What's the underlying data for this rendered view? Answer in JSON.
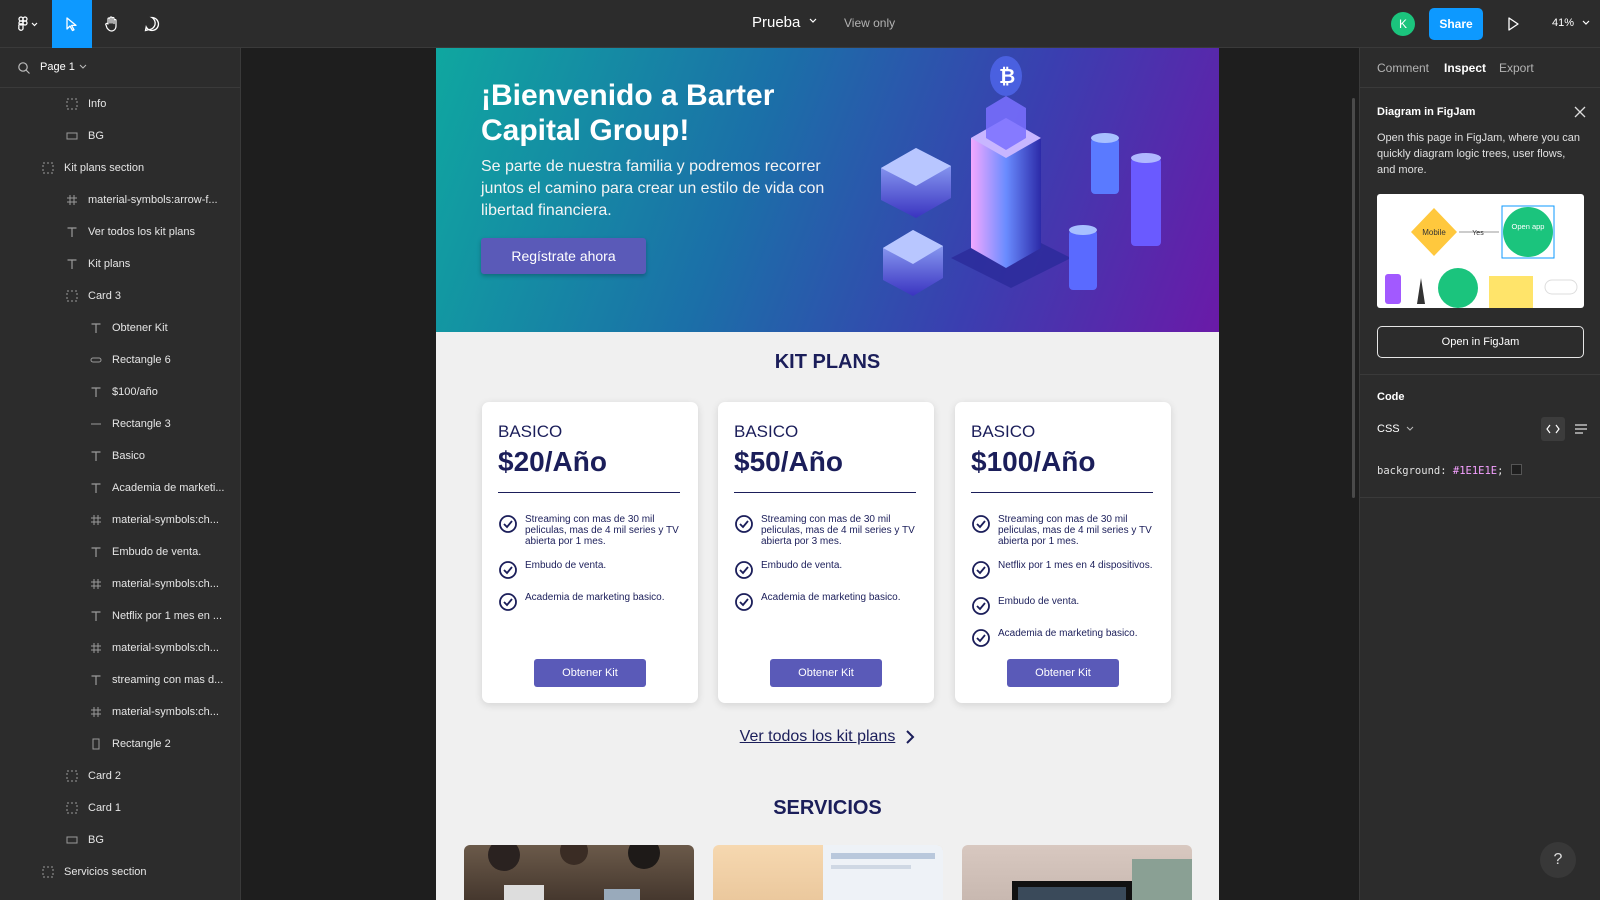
{
  "toolbar": {
    "doc_title": "Prueba",
    "view_only": "View only",
    "avatar_initial": "K",
    "share_label": "Share",
    "zoom": "41%"
  },
  "layers": {
    "page_label": "Page 1",
    "items": [
      {
        "name": "Info",
        "icon": "frame-dashed-icon",
        "indent": 1
      },
      {
        "name": "BG",
        "icon": "rectangle-icon",
        "indent": 1
      },
      {
        "name": "Kit plans section",
        "icon": "frame-dashed-icon",
        "indent": 0
      },
      {
        "name": "material-symbols:arrow-f...",
        "icon": "frame-grid-icon",
        "indent": 1
      },
      {
        "name": "Ver todos los kit plans",
        "icon": "text-icon",
        "indent": 1
      },
      {
        "name": "Kit plans",
        "icon": "text-icon",
        "indent": 1
      },
      {
        "name": "Card 3",
        "icon": "frame-dashed-icon",
        "indent": 1
      },
      {
        "name": "Obtener Kit",
        "icon": "text-icon",
        "indent": 2
      },
      {
        "name": "Rectangle 6",
        "icon": "rounded-rect-icon",
        "indent": 2
      },
      {
        "name": "$100/año",
        "icon": "text-icon",
        "indent": 2
      },
      {
        "name": "Rectangle 3",
        "icon": "line-icon",
        "indent": 2
      },
      {
        "name": "Basico",
        "icon": "text-icon",
        "indent": 2
      },
      {
        "name": "Academia de marketi...",
        "icon": "text-icon",
        "indent": 2
      },
      {
        "name": "material-symbols:ch...",
        "icon": "frame-grid-icon",
        "indent": 2
      },
      {
        "name": "Embudo de venta.",
        "icon": "text-icon",
        "indent": 2
      },
      {
        "name": "material-symbols:ch...",
        "icon": "frame-grid-icon",
        "indent": 2
      },
      {
        "name": "Netflix por 1 mes en ...",
        "icon": "text-icon",
        "indent": 2
      },
      {
        "name": "material-symbols:ch...",
        "icon": "frame-grid-icon",
        "indent": 2
      },
      {
        "name": "streaming con mas d...",
        "icon": "text-icon",
        "indent": 2
      },
      {
        "name": "material-symbols:ch...",
        "icon": "frame-grid-icon",
        "indent": 2
      },
      {
        "name": "Rectangle 2",
        "icon": "tall-rect-icon",
        "indent": 2
      },
      {
        "name": "Card 2",
        "icon": "frame-dashed-icon",
        "indent": 1
      },
      {
        "name": "Card 1",
        "icon": "frame-dashed-icon",
        "indent": 1
      },
      {
        "name": "BG",
        "icon": "rectangle-icon",
        "indent": 1
      },
      {
        "name": "Servicios section",
        "icon": "frame-dashed-icon",
        "indent": 0
      }
    ]
  },
  "hero": {
    "title": "¡Bienvenido a Barter Capital Group!",
    "subtitle": "Se parte de nuestra familia y podremos recorrer juntos el camino para crear un estilo de vida con libertad financiera.",
    "cta": "Regístrate ahora"
  },
  "kit_plans": {
    "title": "KIT PLANS",
    "cards": [
      {
        "tier": "BASICO",
        "price": "$20/Año",
        "features": [
          "Streaming  con mas de 30 mil peliculas, mas de 4 mil series y TV abierta por 1 mes.",
          "Embudo de venta.",
          "Academia de marketing basico."
        ],
        "button": "Obtener Kit"
      },
      {
        "tier": "BASICO",
        "price": "$50/Año",
        "features": [
          "Streaming  con mas de 30 mil peliculas, mas de 4 mil series y TV abierta por 3 mes.",
          "Embudo de venta.",
          "Academia de marketing basico."
        ],
        "button": "Obtener Kit"
      },
      {
        "tier": "BASICO",
        "price": "$100/Año",
        "features": [
          "Streaming  con mas de 30 mil peliculas, mas de 4 mil series y TV abierta por 1 mes.",
          "Netflix por 1 mes en 4 dispositivos.",
          "Embudo de venta.",
          "Academia de marketing basico."
        ],
        "button": "Obtener Kit"
      }
    ],
    "see_all": "Ver todos los kit plans"
  },
  "services": {
    "title": "SERVICIOS"
  },
  "inspect": {
    "tabs": [
      "Comment",
      "Inspect",
      "Export"
    ],
    "active_tab": "Inspect",
    "figjam_title": "Diagram in FigJam",
    "figjam_desc": "Open this page in FigJam, where you can quickly diagram logic trees, user flows, and more.",
    "figjam_illustration": {
      "mobile": "Mobile",
      "yes": "Yes",
      "open_app": "Open app"
    },
    "figjam_button": "Open in FigJam",
    "code_title": "Code",
    "code_lang": "CSS",
    "code_property": "background:",
    "code_value": "#1E1E1E",
    "code_semicolon": ";"
  },
  "colors": {
    "accent": "#0d99ff",
    "brand_navy": "#1b1e5a",
    "button_purple": "#5a5ab8",
    "canvas_bg": "#1E1E1E"
  },
  "help_label": "?"
}
